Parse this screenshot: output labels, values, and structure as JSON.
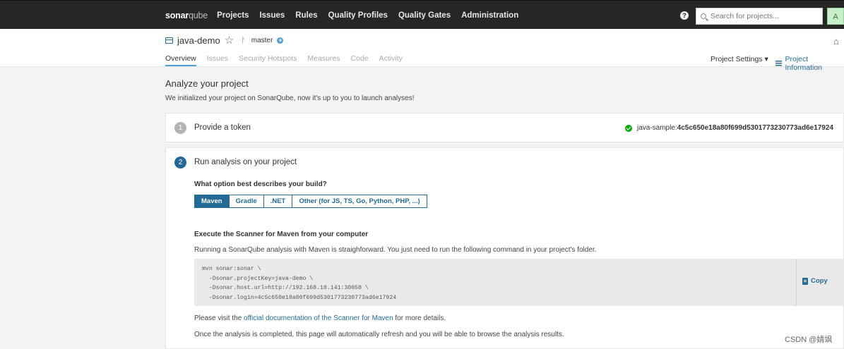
{
  "nav": {
    "logo_bold": "sonar",
    "logo_rest": "qube",
    "links": [
      "Projects",
      "Issues",
      "Rules",
      "Quality Profiles",
      "Quality Gates",
      "Administration"
    ],
    "help_glyph": "?",
    "search_placeholder": "Search for projects...",
    "avatar_letter": "A"
  },
  "project": {
    "name": "java-demo",
    "branch": "master",
    "tabs": [
      "Overview",
      "Issues",
      "Security Hotspots",
      "Measures",
      "Code",
      "Activity"
    ],
    "settings_label": "Project Settings ▾",
    "info_label": "Project Information"
  },
  "page": {
    "title": "Analyze your project",
    "subtitle": "We initialized your project on SonarQube, now it's up to you to launch analyses!"
  },
  "step1": {
    "number": "1",
    "title": "Provide a token",
    "token_prefix": "java-sample: ",
    "token_value": "4c5c650e18a80f699d5301773230773ad6e17924"
  },
  "step2": {
    "number": "2",
    "title": "Run analysis on your project",
    "question": "What option best describes your build?",
    "options": [
      "Maven",
      "Gradle",
      ".NET",
      "Other (for JS, TS, Go, Python, PHP, ...)"
    ],
    "selected_option": "Maven",
    "exec_title": "Execute the Scanner for Maven from your computer",
    "exec_desc": "Running a SonarQube analysis with Maven is straighforward. You just need to run the following command in your project's folder.",
    "code": "mvn sonar:sonar \\\n  -Dsonar.projectKey=java-demo \\\n  -Dsonar.host.url=http://192.168.10.141:30058 \\\n  -Dsonar.login=4c5c650e18a80f699d5301773230773ad6e17924",
    "copy_label": "Copy",
    "visit_prefix": "Please visit the ",
    "visit_link": "official documentation of the Scanner for Maven",
    "visit_suffix": " for more details.",
    "once_text": "Once the analysis is completed, this page will automatically refresh and you will be able to browse the analysis results."
  },
  "watermark": "CSDN @婧飒",
  "colors": {
    "accent": "#236a97",
    "success": "#00aa00",
    "nav_bg": "#262626"
  }
}
